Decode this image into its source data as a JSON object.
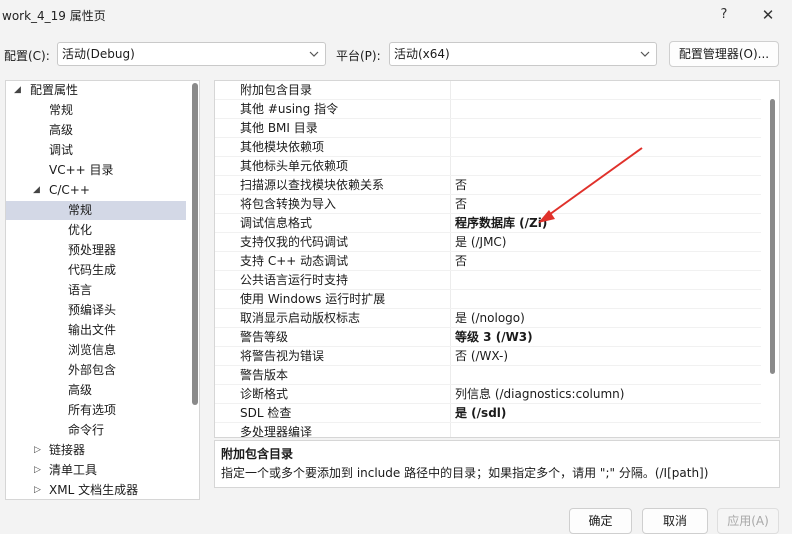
{
  "window": {
    "title": "work_4_19 属性页",
    "help": "?",
    "close": "✕"
  },
  "config": {
    "label": "配置(C):",
    "value": "活动(Debug)",
    "platform_label": "平台(P):",
    "platform_value": "活动(x64)",
    "manager_button": "配置管理器(O)..."
  },
  "tree": {
    "items": [
      {
        "label": "配置属性",
        "expanded": true
      },
      {
        "label": "常规"
      },
      {
        "label": "高级"
      },
      {
        "label": "调试"
      },
      {
        "label": "VC++ 目录"
      },
      {
        "label": "C/C++",
        "expanded": true
      },
      {
        "label": "常规",
        "selected": true
      },
      {
        "label": "优化"
      },
      {
        "label": "预处理器"
      },
      {
        "label": "代码生成"
      },
      {
        "label": "语言"
      },
      {
        "label": "预编译头"
      },
      {
        "label": "输出文件"
      },
      {
        "label": "浏览信息"
      },
      {
        "label": "外部包含"
      },
      {
        "label": "高级"
      },
      {
        "label": "所有选项"
      },
      {
        "label": "命令行"
      },
      {
        "label": "链接器",
        "collapsed": true
      },
      {
        "label": "清单工具",
        "collapsed": true
      },
      {
        "label": "XML 文档生成器",
        "collapsed": true
      }
    ]
  },
  "properties": [
    {
      "name": "附加包含目录",
      "value": ""
    },
    {
      "name": "其他 #using 指令",
      "value": ""
    },
    {
      "name": "其他 BMI 目录",
      "value": ""
    },
    {
      "name": "其他模块依赖项",
      "value": ""
    },
    {
      "name": "其他标头单元依赖项",
      "value": ""
    },
    {
      "name": "扫描源以查找模块依赖关系",
      "value": "否"
    },
    {
      "name": "将包含转换为导入",
      "value": "否"
    },
    {
      "name": "调试信息格式",
      "value": "程序数据库 (/Zi)",
      "bold": true
    },
    {
      "name": "支持仅我的代码调试",
      "value": "是 (/JMC)"
    },
    {
      "name": "支持 C++ 动态调试",
      "value": "否"
    },
    {
      "name": "公共语言运行时支持",
      "value": ""
    },
    {
      "name": "使用 Windows 运行时扩展",
      "value": ""
    },
    {
      "name": "取消显示启动版权标志",
      "value": "是 (/nologo)"
    },
    {
      "name": "警告等级",
      "value": "等级 3 (/W3)",
      "bold": true
    },
    {
      "name": "将警告视为错误",
      "value": "否 (/WX-)"
    },
    {
      "name": "警告版本",
      "value": ""
    },
    {
      "name": "诊断格式",
      "value": "列信息 (/diagnostics:column)"
    },
    {
      "name": "SDL 检查",
      "value": "是 (/sdl)",
      "bold": true
    },
    {
      "name": "多处理器编译",
      "value": ""
    }
  ],
  "description": {
    "title": "附加包含目录",
    "text": "指定一个或多个要添加到 include 路径中的目录；如果指定多个，请用 \";\" 分隔。(/I[path])"
  },
  "buttons": {
    "ok": "确定",
    "cancel": "取消",
    "apply": "应用(A)"
  },
  "colors": {
    "annotation_arrow": "#e0312b",
    "selection": "#d3d8e6"
  }
}
